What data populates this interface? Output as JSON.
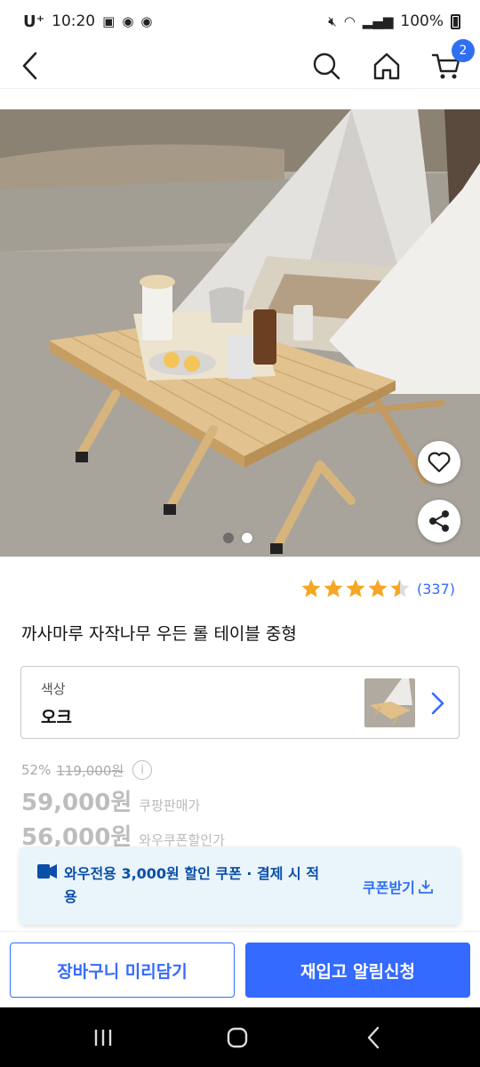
{
  "status_bar": {
    "carrier": "U⁺",
    "time": "10:20",
    "battery": "100%"
  },
  "header": {
    "cart_count": "2"
  },
  "gallery": {
    "current_index": 2,
    "total": 2
  },
  "product": {
    "review_count": "(337)",
    "rating": 4.5,
    "title": "까사마루 자작나무 우든 롤 테이블 중형"
  },
  "option": {
    "label": "색상",
    "value": "오크"
  },
  "price": {
    "discount_rate": "52%",
    "original_price": "119,000원",
    "sale_price": "59,000원",
    "sale_caption": "쿠팡판매가",
    "coupon_price": "56,000원",
    "coupon_caption": "와우쿠폰할인가"
  },
  "coupon_banner": {
    "text": "와우전용 3,000원 할인 쿠폰 · 결제 시 적용",
    "action": "쿠폰받기"
  },
  "actions": {
    "cart": "장바구니 미리담기",
    "restock": "재입고 알림신청"
  },
  "colors": {
    "accent": "#346aff",
    "star": "#f5a623",
    "coupon_bg": "#eaf4fb"
  }
}
